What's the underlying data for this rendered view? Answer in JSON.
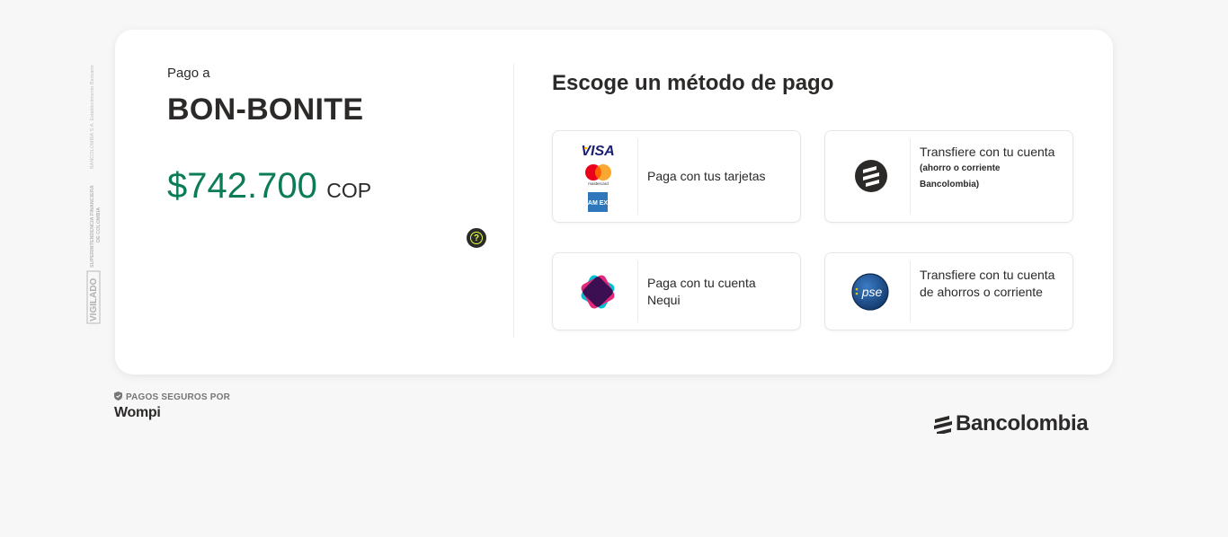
{
  "sidebar": {
    "vigilado": "VIGILADO",
    "superintendencia": "SUPERINTENDENCIA FINANCIERA",
    "de_colombia": "DE COLOMBIA",
    "establecimiento": "BANCOLOMBIA S.A. Establecimiento Bancario"
  },
  "payment": {
    "pay_to_label": "Pago a",
    "merchant": "BON-BONITE",
    "amount": "$742.700",
    "currency": "COP",
    "help_symbol": "?"
  },
  "methods": {
    "title": "Escoge un método de pago",
    "options": [
      {
        "label": "Paga con tus tarjetas",
        "icons": [
          "visa-logo",
          "mastercard-logo",
          "amex-logo"
        ],
        "visa_text": "VISA",
        "mastercard_text": "mastercard",
        "amex_text": "AM EX"
      },
      {
        "label": "Transfiere con tu cuenta",
        "note": "(ahorro o corriente Bancolombia)",
        "icon": "bancolombia-icon"
      },
      {
        "label": "Paga con tu cuenta Nequi",
        "icon": "nequi-icon"
      },
      {
        "label": "Transfiere con tu cuenta de ahorros o corriente",
        "icon": "pse-icon",
        "pse_text": "pse"
      }
    ]
  },
  "footer": {
    "secure_label": "PAGOS SEGUROS POR",
    "provider": "Wompi",
    "bank_brand": "Bancolombia"
  },
  "colors": {
    "amount": "#0b7d55",
    "text": "#2c2a29",
    "background": "#f7f7f7",
    "help_accent": "#dfff3d"
  }
}
